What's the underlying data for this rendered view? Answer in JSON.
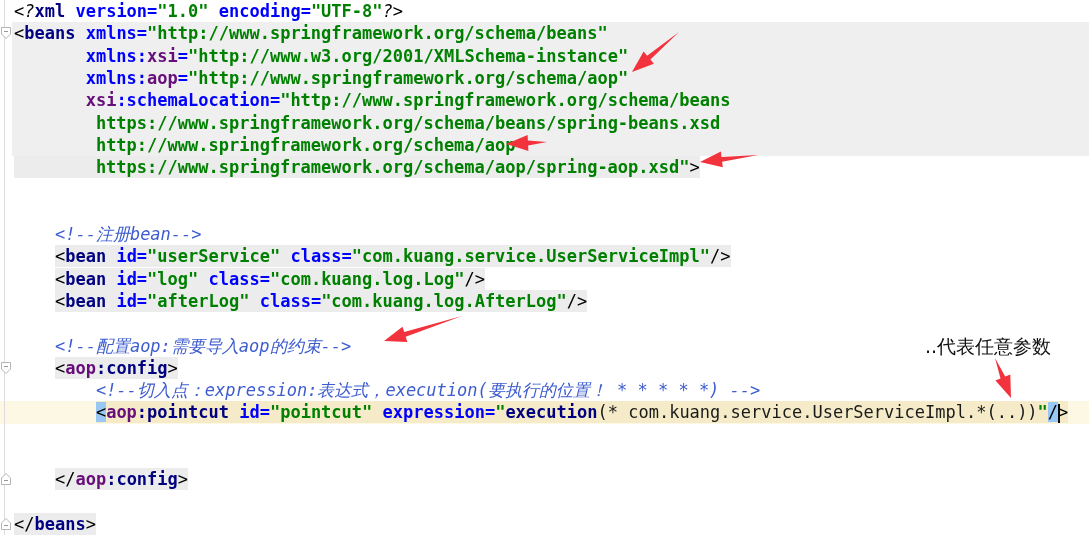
{
  "editor": {
    "lines": [
      {
        "kind": "code",
        "highlighted": false,
        "current": false,
        "segments": [
          {
            "text": "<?",
            "kind": "pi"
          },
          {
            "text": "xml",
            "kind": "tag"
          },
          {
            "text": " version=",
            "kind": "attr"
          },
          {
            "text": "\"1.0\"",
            "kind": "str"
          },
          {
            "text": " encoding=",
            "kind": "attr"
          },
          {
            "text": "\"UTF-8\"",
            "kind": "str"
          },
          {
            "text": "?>",
            "kind": "pi"
          }
        ]
      },
      {
        "kind": "block",
        "highlighted": true,
        "current": false,
        "fold_start": true,
        "segments": [
          {
            "text": "<",
            "kind": "punct"
          },
          {
            "text": "beans",
            "kind": "tag"
          },
          {
            "text": " xmlns=",
            "kind": "attr"
          },
          {
            "text": "\"http://www.springframework.org/schema/beans\"",
            "kind": "str"
          }
        ]
      },
      {
        "kind": "block",
        "highlighted": true,
        "current": false,
        "segments": [
          {
            "text": "       xmlns:",
            "kind": "attr"
          },
          {
            "text": "xsi",
            "kind": "ns"
          },
          {
            "text": "=",
            "kind": "attr"
          },
          {
            "text": "\"http://www.w3.org/2001/XMLSchema-instance\"",
            "kind": "str"
          }
        ]
      },
      {
        "kind": "block",
        "highlighted": true,
        "current": false,
        "segments": [
          {
            "text": "       xmlns:",
            "kind": "attr"
          },
          {
            "text": "aop",
            "kind": "ns"
          },
          {
            "text": "=",
            "kind": "attr"
          },
          {
            "text": "\"http://www.springframework.org/schema/aop\"",
            "kind": "str"
          }
        ]
      },
      {
        "kind": "block",
        "highlighted": true,
        "current": false,
        "segments": [
          {
            "text": "       xsi",
            "kind": "ns"
          },
          {
            "text": ":schemaLocation=",
            "kind": "attr"
          },
          {
            "text": "\"http://www.springframework.org/schema/beans",
            "kind": "str"
          }
        ]
      },
      {
        "kind": "block",
        "highlighted": true,
        "current": false,
        "segments": [
          {
            "text": "        https://www.springframework.org/schema/beans/spring-beans.xsd",
            "kind": "str"
          }
        ]
      },
      {
        "kind": "block",
        "highlighted": true,
        "current": false,
        "segments": [
          {
            "text": "        http://www.springframework.org/schema/aop",
            "kind": "str"
          }
        ]
      },
      {
        "kind": "tail",
        "highlighted": true,
        "current": false,
        "segments": [
          {
            "text": "        https://www.springframework.org/schema/aop/spring-aop.xsd\"",
            "kind": "str"
          },
          {
            "text": ">",
            "kind": "punct"
          }
        ]
      },
      {
        "kind": "blank",
        "current": false
      },
      {
        "kind": "blank",
        "current": false
      },
      {
        "kind": "code",
        "highlighted": false,
        "current": false,
        "segments": [
          {
            "text": "    <!--注册bean-->",
            "kind": "cmt"
          }
        ]
      },
      {
        "kind": "code",
        "highlighted": true,
        "current": false,
        "segments": [
          {
            "text": "    <",
            "kind": "punct"
          },
          {
            "text": "bean",
            "kind": "tag"
          },
          {
            "text": " id=",
            "kind": "attr"
          },
          {
            "text": "\"userService\"",
            "kind": "str"
          },
          {
            "text": " class=",
            "kind": "attr"
          },
          {
            "text": "\"com.kuang.service.UserServiceImpl\"",
            "kind": "str"
          },
          {
            "text": "/>",
            "kind": "punct"
          }
        ]
      },
      {
        "kind": "code",
        "highlighted": true,
        "current": false,
        "segments": [
          {
            "text": "    <",
            "kind": "punct"
          },
          {
            "text": "bean",
            "kind": "tag"
          },
          {
            "text": " id=",
            "kind": "attr"
          },
          {
            "text": "\"log\"",
            "kind": "str"
          },
          {
            "text": " class=",
            "kind": "attr"
          },
          {
            "text": "\"com.kuang.log.Log\"",
            "kind": "str"
          },
          {
            "text": "/>",
            "kind": "punct"
          }
        ]
      },
      {
        "kind": "code",
        "highlighted": true,
        "current": false,
        "segments": [
          {
            "text": "    <",
            "kind": "punct"
          },
          {
            "text": "bean",
            "kind": "tag"
          },
          {
            "text": " id=",
            "kind": "attr"
          },
          {
            "text": "\"afterLog\"",
            "kind": "str"
          },
          {
            "text": " class=",
            "kind": "attr"
          },
          {
            "text": "\"com.kuang.log.AfterLog\"",
            "kind": "str"
          },
          {
            "text": "/>",
            "kind": "punct"
          }
        ]
      },
      {
        "kind": "blank",
        "current": false
      },
      {
        "kind": "code",
        "highlighted": false,
        "current": false,
        "segments": [
          {
            "text": "    <!--配置aop:需要导入aop的约束-->",
            "kind": "cmt"
          }
        ]
      },
      {
        "kind": "code",
        "highlighted": true,
        "current": false,
        "fold_start": true,
        "segments": [
          {
            "text": "    <",
            "kind": "punct"
          },
          {
            "text": "aop",
            "kind": "ns"
          },
          {
            "text": ":config",
            "kind": "tag"
          },
          {
            "text": ">",
            "kind": "punct"
          }
        ]
      },
      {
        "kind": "code",
        "highlighted": false,
        "current": false,
        "segments": [
          {
            "text": "        <!--切入点：expression:表达式，execution(要执行的位置！ * * * * *) -->",
            "kind": "cmt"
          }
        ]
      },
      {
        "kind": "code",
        "highlighted": true,
        "current": true,
        "segments": [
          {
            "text": "        <",
            "kind": "match"
          },
          {
            "text": "aop",
            "kind": "ns"
          },
          {
            "text": ":pointcut",
            "kind": "tag"
          },
          {
            "text": " id=",
            "kind": "attr"
          },
          {
            "text": "\"pointcut\"",
            "kind": "str"
          },
          {
            "text": " expression=",
            "kind": "attr"
          },
          {
            "text": "\"",
            "kind": "str"
          },
          {
            "text": "execution",
            "kind": "kw"
          },
          {
            "text": "(* com.kuang.service.UserServiceImpl.*(..))",
            "kind": "plain"
          },
          {
            "text": "\"",
            "kind": "str"
          },
          {
            "text": "/",
            "kind": "match"
          },
          {
            "text": ">",
            "kind": "punct",
            "caret_before": true
          }
        ]
      },
      {
        "kind": "blank",
        "current": false
      },
      {
        "kind": "blank",
        "current": false
      },
      {
        "kind": "code",
        "highlighted": true,
        "current": false,
        "fold_end": true,
        "segments": [
          {
            "text": "    </",
            "kind": "punct"
          },
          {
            "text": "aop",
            "kind": "ns"
          },
          {
            "text": ":config",
            "kind": "tag"
          },
          {
            "text": ">",
            "kind": "punct"
          }
        ]
      },
      {
        "kind": "blank",
        "current": false
      },
      {
        "kind": "code",
        "highlighted": true,
        "current": false,
        "fold_end": true,
        "segments": [
          {
            "text": "</",
            "kind": "punct"
          },
          {
            "text": "beans",
            "kind": "tag"
          },
          {
            "text": ">",
            "kind": "punct"
          }
        ]
      }
    ]
  },
  "annotation": {
    "note": "..代表任意参数"
  }
}
